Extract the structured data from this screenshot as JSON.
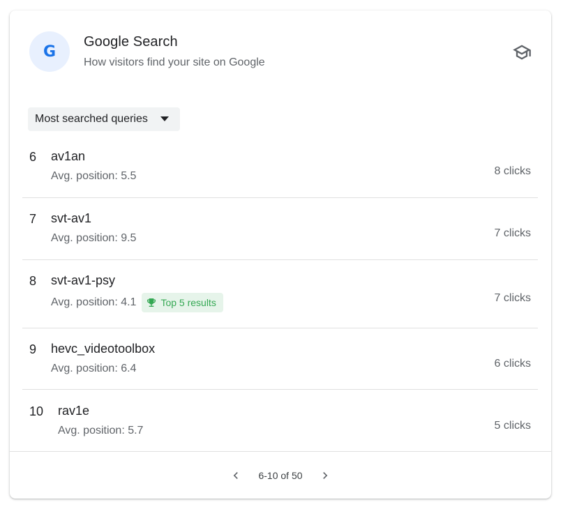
{
  "header": {
    "badge_letter": "G",
    "title": "Google Search",
    "subtitle": "How visitors find your site on Google",
    "learn_icon": "school-icon"
  },
  "filter": {
    "selected": "Most searched queries"
  },
  "queries": [
    {
      "rank": "6",
      "query": "av1an",
      "avg": "Avg. position: 5.5",
      "clicks": "8 clicks",
      "badge": null
    },
    {
      "rank": "7",
      "query": "svt-av1",
      "avg": "Avg. position: 9.5",
      "clicks": "7 clicks",
      "badge": null
    },
    {
      "rank": "8",
      "query": "svt-av1-psy",
      "avg": "Avg. position: 4.1",
      "clicks": "7 clicks",
      "badge": "Top 5 results"
    },
    {
      "rank": "9",
      "query": "hevc_videotoolbox",
      "avg": "Avg. position: 6.4",
      "clicks": "6 clicks",
      "badge": null
    },
    {
      "rank": "10",
      "query": "rav1e",
      "avg": "Avg. position: 5.7",
      "clicks": "5 clicks",
      "badge": null
    }
  ],
  "pagination": {
    "label": "6-10 of 50",
    "prev_icon": "chevron-left-icon",
    "next_icon": "chevron-right-icon"
  },
  "colors": {
    "accent": "#1a73e8",
    "badge_green": "#34a853",
    "badge_bg": "#e6f4ea"
  }
}
